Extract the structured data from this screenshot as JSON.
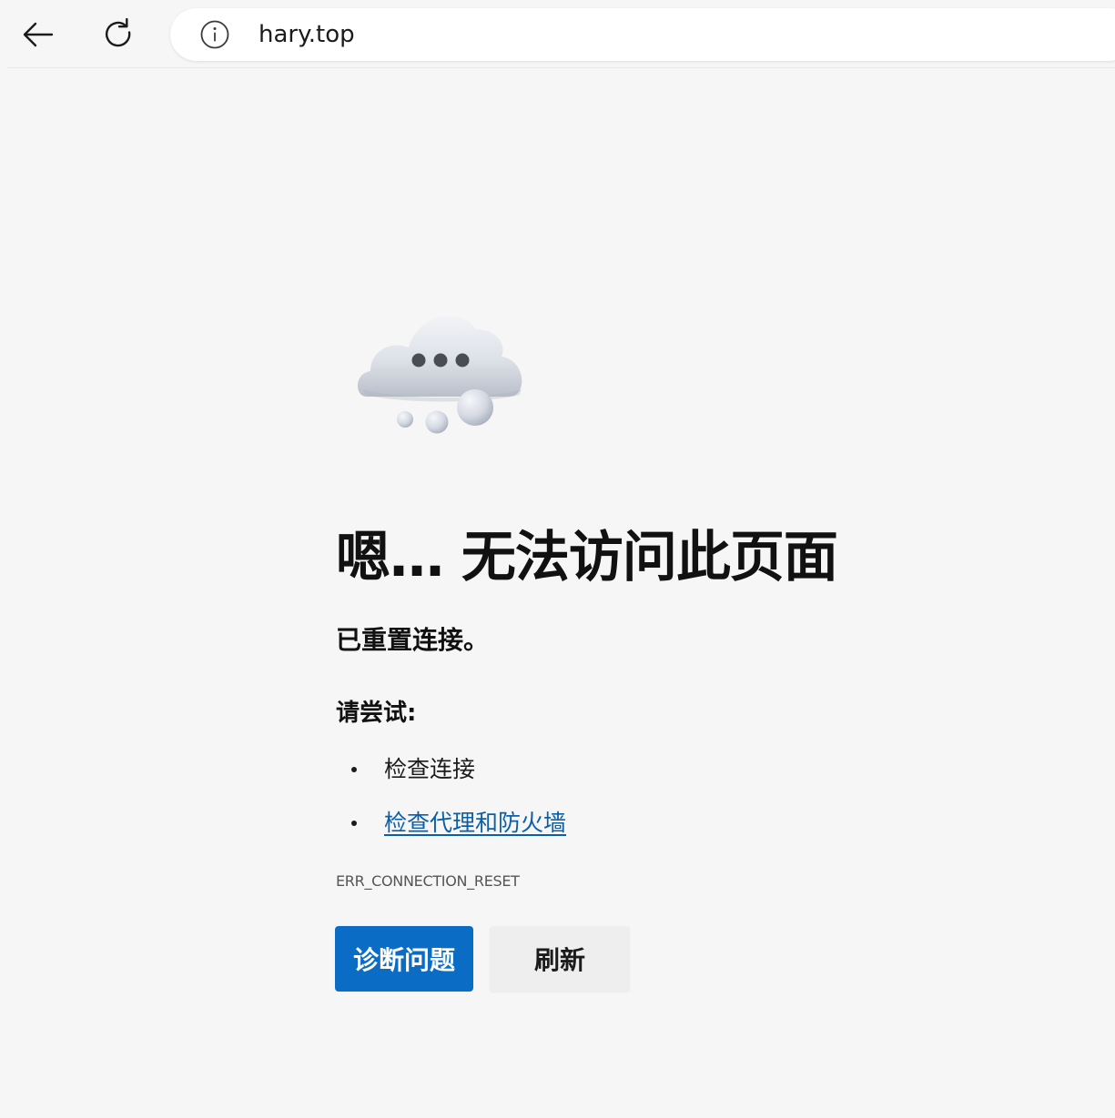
{
  "toolbar": {
    "back_icon": "back-arrow-icon",
    "reload_icon": "reload-icon",
    "site_info_icon": "info-icon",
    "url": "hary.top"
  },
  "error_page": {
    "illustration_icon": "cloud-thinking-icon",
    "title": "嗯… 无法访问此页面",
    "subtitle": "已重置连接。",
    "try_heading": "请尝试:",
    "suggestions": [
      {
        "text": "检查连接",
        "is_link": false
      },
      {
        "text": "检查代理和防火墙",
        "is_link": true
      }
    ],
    "error_code": "ERR_CONNECTION_RESET",
    "buttons": {
      "diagnose": "诊断问题",
      "refresh": "刷新"
    }
  },
  "colors": {
    "background": "#f7f6f6",
    "primary_button": "#0a6cc5",
    "secondary_button": "#efeeee",
    "link": "#0b5fa8"
  }
}
